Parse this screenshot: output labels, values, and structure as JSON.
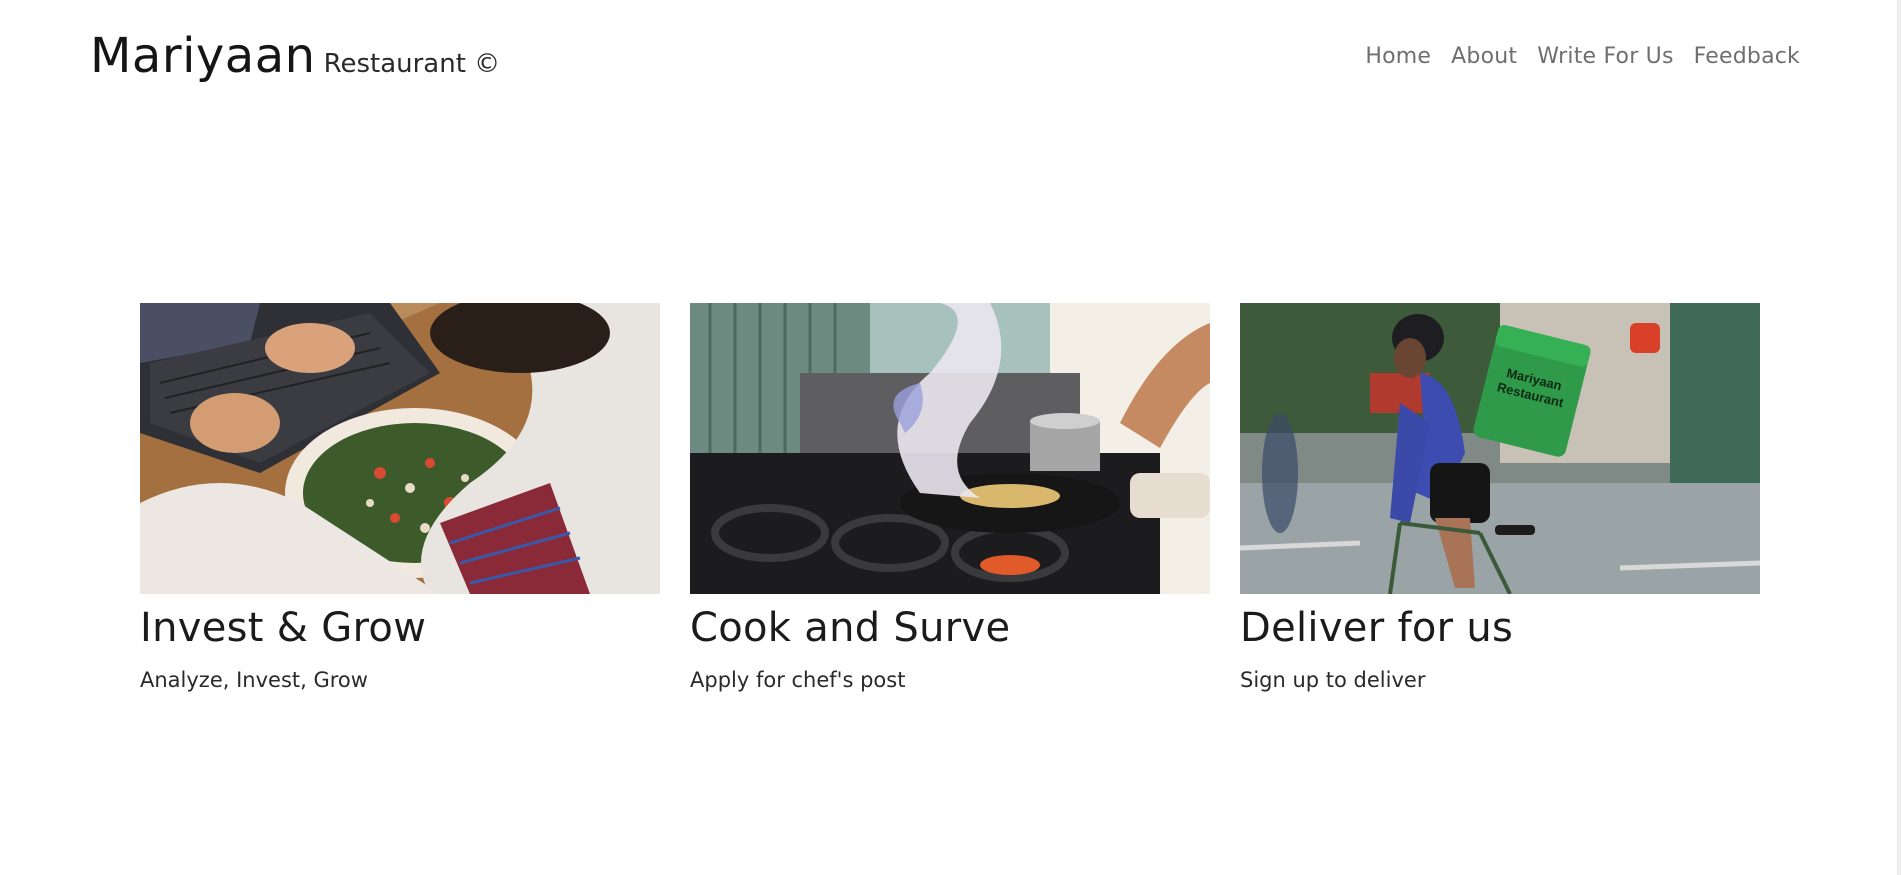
{
  "header": {
    "brand_name": "Mariyaan",
    "brand_sub": "Restaurant ©"
  },
  "nav": {
    "items": [
      {
        "label": "Home"
      },
      {
        "label": "About"
      },
      {
        "label": "Write For Us"
      },
      {
        "label": "Feedback"
      }
    ]
  },
  "cards": [
    {
      "title": "Invest & Grow",
      "subtitle": "Analyze, Invest, Grow",
      "image": "laptop-salad-photo"
    },
    {
      "title": "Cook and Surve",
      "subtitle": "Apply for chef's post",
      "image": "chef-flambe-photo"
    },
    {
      "title": "Deliver for us",
      "subtitle": "Sign up to deliver",
      "image": "delivery-cyclist-photo"
    }
  ],
  "photo_text": {
    "bag_line1": "Mariyaan",
    "bag_line2": "Restaurant"
  }
}
